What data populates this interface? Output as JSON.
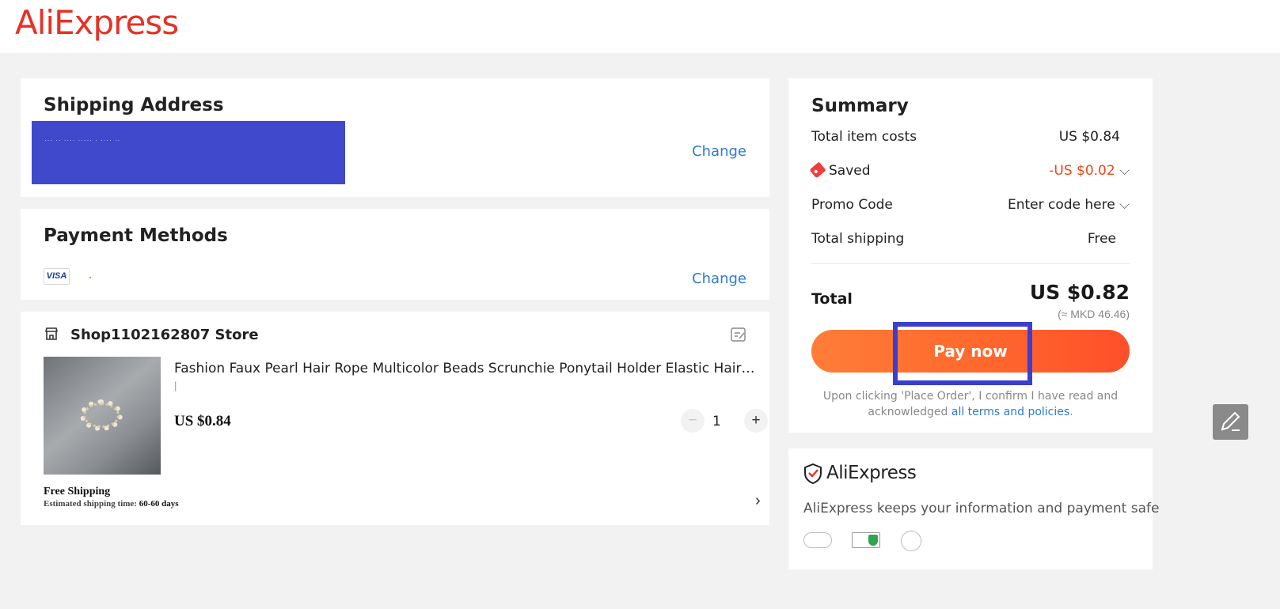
{
  "header": {
    "logo_text": "AliExpress",
    "brand_color": "#e43225"
  },
  "shipping": {
    "title": "Shipping Address",
    "address_redacted": "··· ·· ···· ····· ·  ···· ·· ",
    "change_label": "Change"
  },
  "payment": {
    "title": "Payment Methods",
    "card_brand": "VISA",
    "change_label": "Change"
  },
  "order": {
    "store_name": "Shop1102162807 Store",
    "product_title": "Fashion Faux Pearl Hair Rope Multicolor Beads Scrunchie Ponytail Holder Elastic Hairband Fashion Hair Accessories",
    "sku": "|",
    "price": "US $0.84",
    "quantity": "1",
    "minus_label": "−",
    "plus_label": "+",
    "shipping_title": "Free Shipping",
    "shipping_time_label": "Estimated shipping time: ",
    "shipping_time_value": "60-60 days"
  },
  "summary": {
    "title": "Summary",
    "item_costs_label": "Total item costs",
    "item_costs_value": "US $0.84",
    "saved_label": "Saved",
    "saved_value": "-US $0.02",
    "promo_label": "Promo Code",
    "promo_value": "Enter code here",
    "shipping_label": "Total shipping",
    "shipping_value": "Free",
    "total_label": "Total",
    "total_value": "US $0.82",
    "total_converted": "(≈ MKD 46.46)",
    "pay_label": "Pay now",
    "consent_text": "Upon clicking 'Place Order', I confirm I have read and acknowledged ",
    "consent_link": "all terms and policies",
    "consent_end": "."
  },
  "safety": {
    "brand": "AliExpress",
    "text": "AliExpress keeps your information and payment safe"
  }
}
